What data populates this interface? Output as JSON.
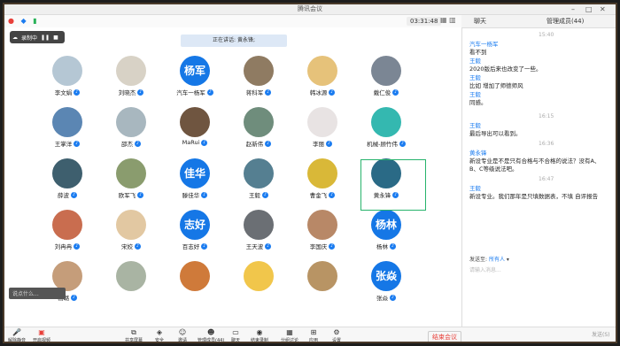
{
  "window": {
    "title": "腾讯会议"
  },
  "top": {
    "timer": "03:31:48",
    "chat_tab": "聊天",
    "members_tab": "管理成员(44)"
  },
  "recording": {
    "label": "录制中"
  },
  "speaking": {
    "label": "正在讲话: 黄永锋;"
  },
  "participants": [
    {
      "name": "李文娟",
      "avatar_text": "",
      "color": "#b5c7d4"
    },
    {
      "name": "刘晓杰",
      "avatar_text": "",
      "color": "#d8d2c6"
    },
    {
      "name": "汽车一杨军",
      "avatar_text": "杨军",
      "color": "#1577e6"
    },
    {
      "name": "蒋科军",
      "avatar_text": "",
      "color": "#8f7b62"
    },
    {
      "name": "韩冰源",
      "avatar_text": "",
      "color": "#e6c27a"
    },
    {
      "name": "戴仁俊",
      "avatar_text": "",
      "color": "#7b8694"
    },
    {
      "name": "王掌洋",
      "avatar_text": "",
      "color": "#5b86b3"
    },
    {
      "name": "邵杰",
      "avatar_text": "",
      "color": "#a8b7bf"
    },
    {
      "name": "MaRui",
      "avatar_text": "",
      "color": "#6f5540"
    },
    {
      "name": "赵新伟",
      "avatar_text": "",
      "color": "#6f8d7c"
    },
    {
      "name": "李丽",
      "avatar_text": "",
      "color": "#e8e3e3"
    },
    {
      "name": "机械-顾竹伟",
      "avatar_text": "",
      "color": "#34b8b0"
    },
    {
      "name": "薛波",
      "avatar_text": "",
      "color": "#3e5f6e"
    },
    {
      "name": "欧军飞",
      "avatar_text": "",
      "color": "#8a9c6e"
    },
    {
      "name": "滕佳华",
      "avatar_text": "佳华",
      "color": "#1577e6"
    },
    {
      "name": "王毅",
      "avatar_text": "",
      "color": "#557f91"
    },
    {
      "name": "曹金飞",
      "avatar_text": "",
      "color": "#d9b838"
    },
    {
      "name": "黄永锋",
      "avatar_text": "",
      "color": "#2a6a86"
    },
    {
      "name": "刘冉冉",
      "avatar_text": "",
      "color": "#c96d4f"
    },
    {
      "name": "宋姣",
      "avatar_text": "",
      "color": "#e2c8a2"
    },
    {
      "name": "百志好",
      "avatar_text": "志好",
      "color": "#1577e6"
    },
    {
      "name": "王天波",
      "avatar_text": "",
      "color": "#6b6f74"
    },
    {
      "name": "李国庆",
      "avatar_text": "",
      "color": "#b88867"
    },
    {
      "name": "杨林",
      "avatar_text": "杨林",
      "color": "#1577e6"
    },
    {
      "name": "杨璐",
      "avatar_text": "",
      "color": "#c59d7a"
    },
    {
      "name": "",
      "avatar_text": "",
      "color": "#a9b4a3"
    },
    {
      "name": "",
      "avatar_text": "",
      "color": "#cf7a3a"
    },
    {
      "name": "",
      "avatar_text": "",
      "color": "#f1c64b"
    },
    {
      "name": "",
      "avatar_text": "",
      "color": "#b89464"
    },
    {
      "name": "张焱",
      "avatar_text": "张焱",
      "color": "#1577e6"
    }
  ],
  "chat": {
    "times": [
      "15:40",
      "16:15",
      "16:36",
      "16:47"
    ],
    "messages": [
      {
        "who": "汽车一杨军",
        "text": "看不到"
      },
      {
        "who": "王毅",
        "text": "2020版后来也改变了一些。"
      },
      {
        "who": "王毅",
        "text": "比如 增加了师德师风"
      },
      {
        "who": "王毅",
        "text": "同感。"
      },
      {
        "who": "王毅",
        "text": "最后导出可以看到。"
      },
      {
        "who": "黄永锋",
        "text": "新设专业是不是只有合格与不合格的说法？没有A、B、C等级说法吧。"
      },
      {
        "who": "王毅",
        "text": "新设专业。我们那年是只填数据表，不填 自评报告"
      }
    ],
    "send_to_label": "发送至:",
    "send_to_value": "所有人",
    "input_placeholder": "请输入消息...",
    "send_label": "发送(S)"
  },
  "toolbar": {
    "mute": "解除静音",
    "video": "开启视频",
    "share": "共享屏幕",
    "security": "安全",
    "invite": "邀请",
    "members": "管理成员(44)",
    "chat": "聊天",
    "record": "结束录制",
    "breakout": "分组讨论",
    "apps": "应用",
    "settings": "设置",
    "end": "结束会议"
  },
  "reply": {
    "label": "说点什么..."
  }
}
